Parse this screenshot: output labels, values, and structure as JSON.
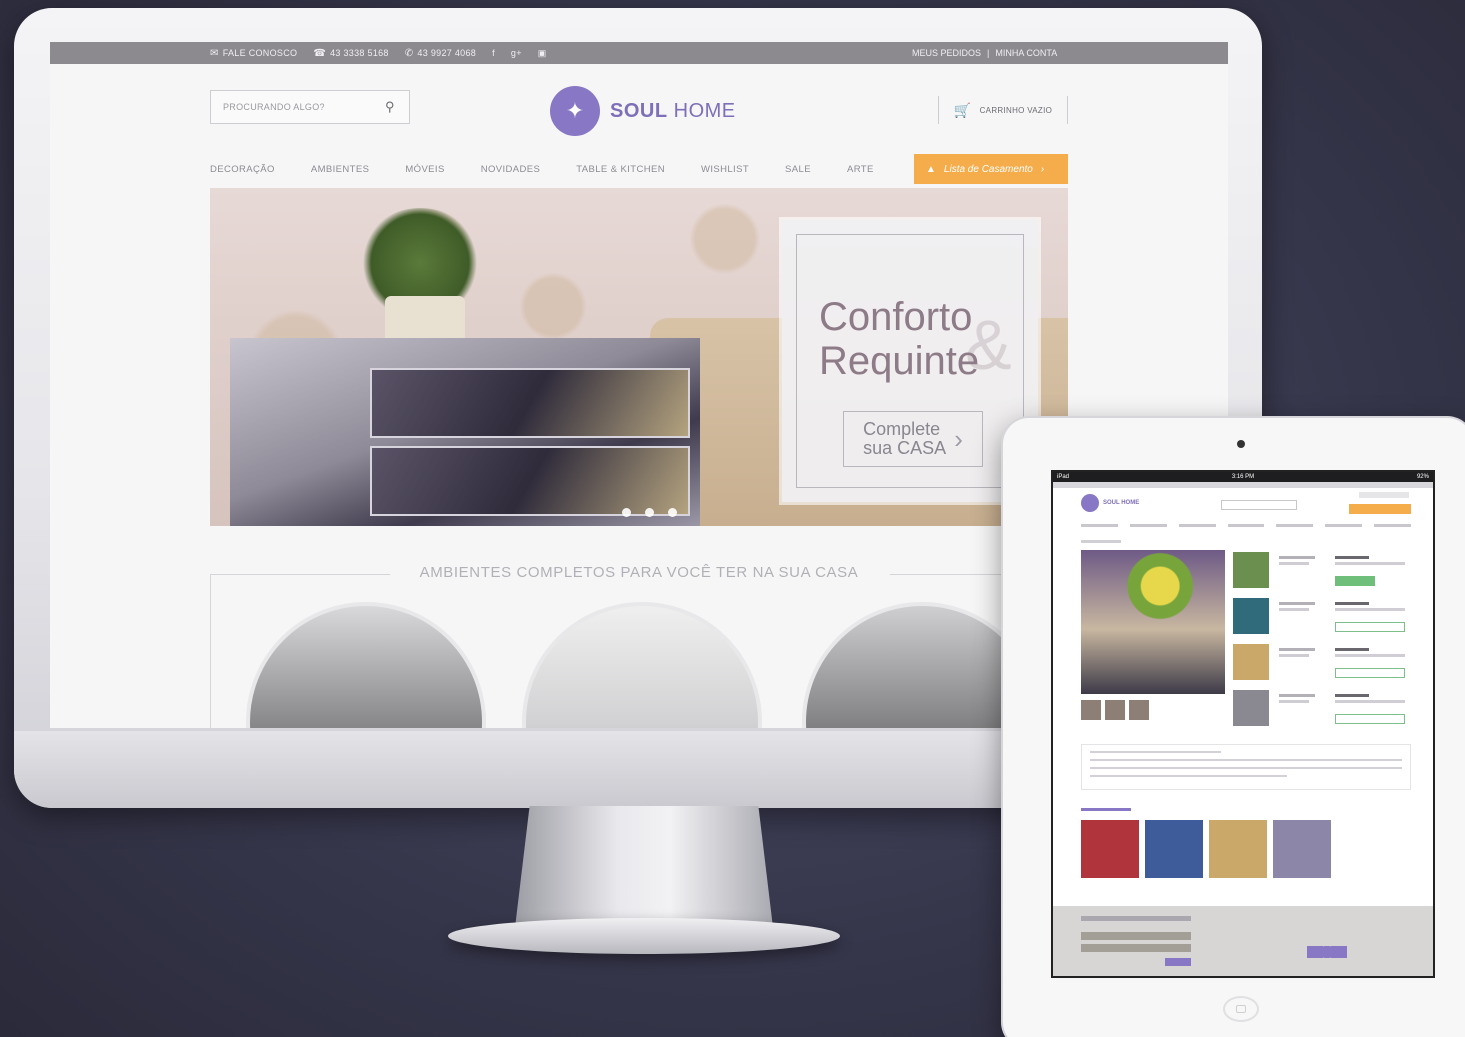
{
  "topbar": {
    "contact": "FALE CONOSCO",
    "phone1": "43 3338 5168",
    "phone2": "43 9927 4068",
    "social": [
      "f",
      "g+",
      "instagram"
    ],
    "my_orders": "MEUS PEDIDOS",
    "separator": "|",
    "my_account": "MINHA CONTA"
  },
  "header": {
    "search_placeholder": "PROCURANDO ALGO?",
    "logo_bold": "SOUL",
    "logo_light": " HOME",
    "cart_label": "CARRINHO VAZIO"
  },
  "nav": {
    "items": [
      "DECORAÇÃO",
      "AMBIENTES",
      "MÓVEIS",
      "NOVIDADES",
      "TABLE & KITCHEN",
      "WISHLIST",
      "SALE",
      "ARTE"
    ],
    "cta": "Lista de Casamento"
  },
  "hero": {
    "line1": "Conforto",
    "line2": "Requinte",
    "amp": "&",
    "button_line1": "Complete",
    "button_line2": "sua CASA"
  },
  "section": {
    "title": "AMBIENTES COMPLETOS PARA VOCÊ TER NA SUA CASA"
  },
  "ipad": {
    "status_left": "iPad",
    "status_time": "3:16 PM",
    "status_right": "92%",
    "logo": "SOUL HOME"
  },
  "colors": {
    "brand_purple": "#8877c4",
    "accent_orange": "#f5ad4c",
    "topbar_gray": "#8c8a8f"
  }
}
